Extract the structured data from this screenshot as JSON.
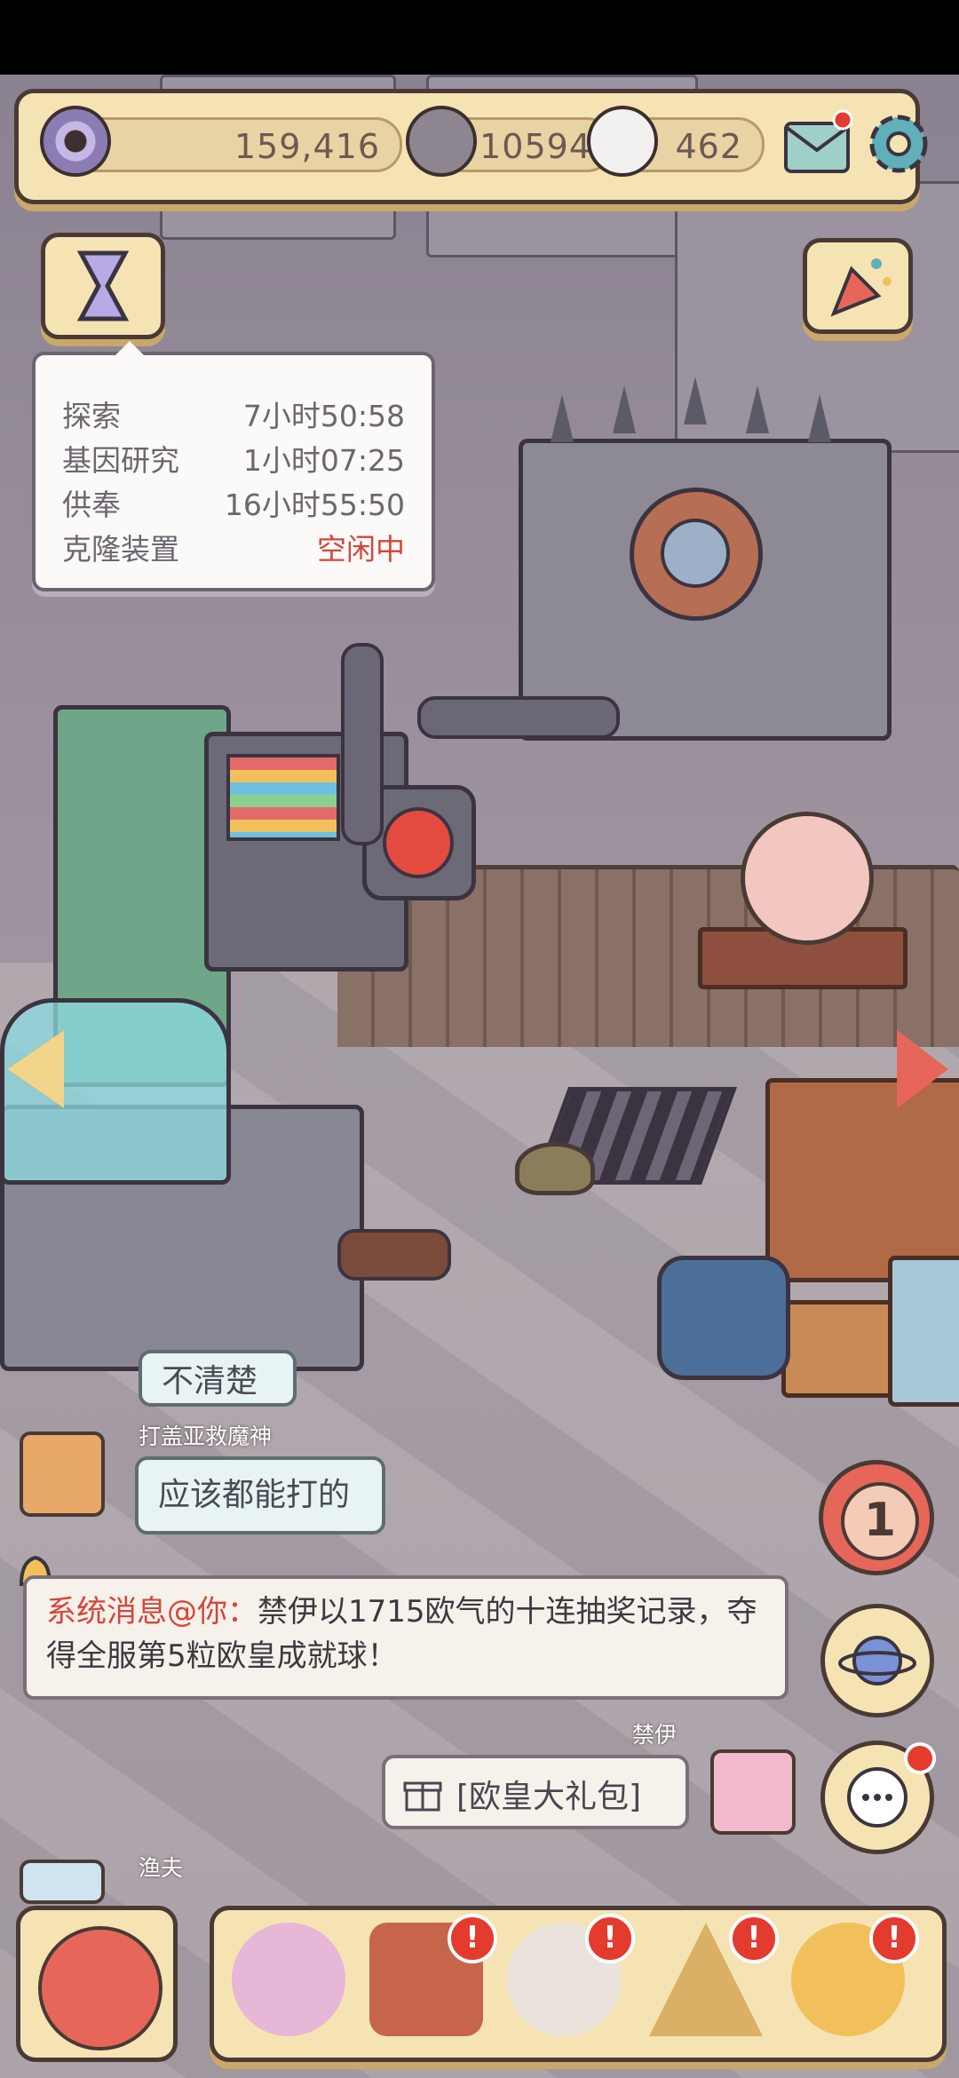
{
  "resources": {
    "eye_value": "159,416",
    "bubble_dark_value": "10594",
    "bubble_light_value": "462"
  },
  "timers": [
    {
      "name": "探索",
      "time": "7小时50:58"
    },
    {
      "name": "基因研究",
      "time": "1小时07:25"
    },
    {
      "name": "供奉",
      "time": "16小时55:50"
    },
    {
      "name": "克隆装置",
      "time": "空闲中"
    }
  ],
  "chat": {
    "partial_text": "不清楚",
    "user1_name": "打盖亚救魔神",
    "user1_text": "应该都能打的",
    "system_label": "系统消息@你：",
    "system_text": "禁伊以1715欧气的十连抽奖记录，夺得全服第5粒欧皇成就球！",
    "user2_name": "禁伊",
    "user2_gift": "[欧皇大礼包]",
    "user3_name": "渔夫"
  },
  "badge_count": "1",
  "colors": {
    "accent_red": "#e43b2f",
    "panel": "#f6e3b4",
    "idle_text": "#d6453a"
  }
}
